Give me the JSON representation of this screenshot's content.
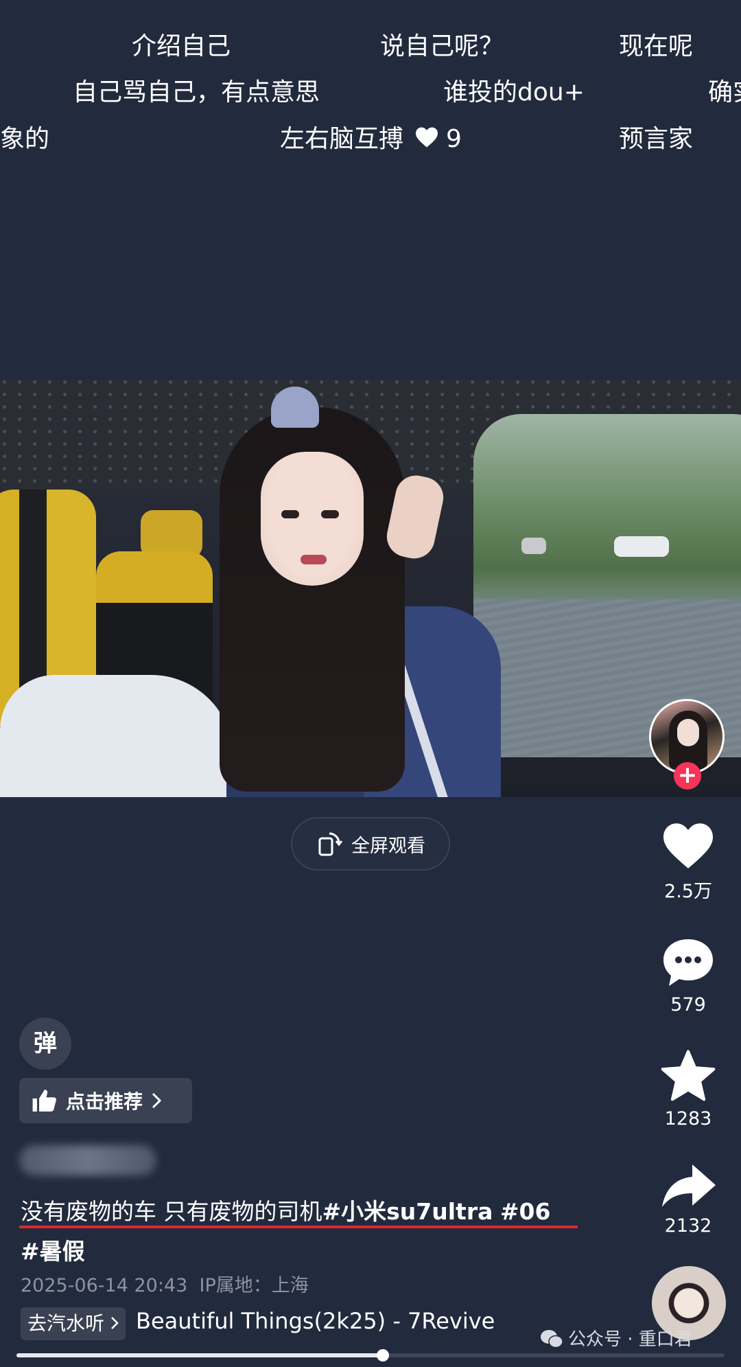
{
  "danmaku": [
    {
      "text": "介绍自己"
    },
    {
      "text": "说自己呢？"
    },
    {
      "text": "现在呢"
    },
    {
      "text": "自己骂自己，有点意思"
    },
    {
      "text": "谁投的dou+"
    },
    {
      "text": "确实"
    },
    {
      "text": "象的"
    },
    {
      "text": "左右脑互搏",
      "likes": "9"
    },
    {
      "text": "预言家"
    }
  ],
  "video": {
    "fullscreen_label": "全屏观看"
  },
  "actions": {
    "likes": "2.5万",
    "comments": "579",
    "favorites": "1283",
    "shares": "2132",
    "follow_plus": "+"
  },
  "controls": {
    "danmu_toggle": "弹",
    "recommend_label": "点击推荐"
  },
  "post": {
    "description_text": "没有废物的车 只有废物的司机",
    "hashtag_1": "#小米su7ultra",
    "hashtag_2": "#06",
    "hashtag_3": "#暑假",
    "timestamp": "2025-06-14 20:43",
    "ip_location": "IP属地：上海"
  },
  "music": {
    "tag_label": "去汽水听",
    "title": "Beautiful Things(2k25) - 7Revive"
  },
  "watermark": {
    "text": "公众号 · 重口君"
  },
  "playback": {
    "progress": 0.517
  },
  "colors": {
    "accent_red": "#e0262f",
    "follow_pink": "#f5345a",
    "background": "#222a3d"
  }
}
